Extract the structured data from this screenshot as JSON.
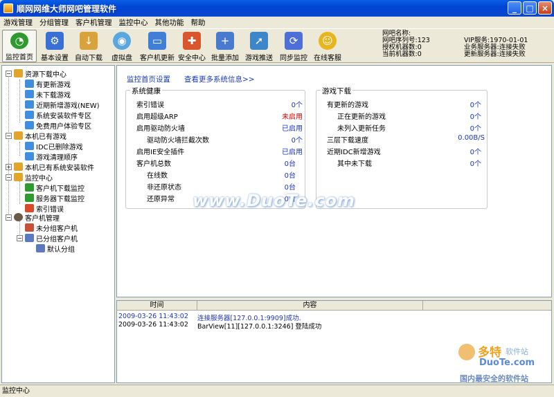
{
  "window": {
    "title": "顺网网维大师网吧管理软件",
    "minimize": "_",
    "maximize": "□",
    "close": "×"
  },
  "menu": [
    "游戏管理",
    "分组管理",
    "客户机管理",
    "监控中心",
    "其他功能",
    "帮助"
  ],
  "toolbar": {
    "buttons": [
      {
        "label": "监控首页",
        "icon": "pie-chart-icon",
        "color": "#2f9a2f"
      },
      {
        "label": "基本设置",
        "icon": "gear-icon",
        "color": "#3a6fd6"
      },
      {
        "label": "自动下载",
        "icon": "download-icon",
        "color": "#d9a23a"
      },
      {
        "label": "虚拟盘",
        "icon": "disk-icon",
        "color": "#5aa7e0"
      },
      {
        "label": "客户机更新",
        "icon": "monitor-icon",
        "color": "#3f7fd8"
      },
      {
        "label": "安全中心",
        "icon": "shield-icon",
        "color": "#d8552e"
      },
      {
        "label": "批量添加",
        "icon": "add-icon",
        "color": "#4a7ad0"
      },
      {
        "label": "游戏推送",
        "icon": "push-icon",
        "color": "#3c86c9"
      },
      {
        "label": "同步监控",
        "icon": "sync-icon",
        "color": "#4f6fd8"
      },
      {
        "label": "在线客服",
        "icon": "smiley-icon",
        "color": "#e9b51f"
      }
    ]
  },
  "netbar_info": {
    "name": "网吧名称:",
    "serial": "网吧序列号:123",
    "licensed": "授权机器数:0",
    "current": "当前机器数:0",
    "vip": "VIP服务:1970-01-01",
    "business": "业务服务器:连接失败",
    "update": "更新服务器:连接失败"
  },
  "tree": {
    "resources": "资源下载中心",
    "updated_games": "有更新游戏",
    "not_downloaded": "未下载游戏",
    "recent_new": "近期新增游戏(NEW)",
    "sys_software": "系统安装软件专区",
    "free_trial": "免费用户体验专区",
    "local_games": "本机已有游戏",
    "idc_deleted": "IDC已删除游戏",
    "cleanup_order": "游戏清理顺序",
    "local_software": "本机已有系统安装软件",
    "monitor_center": "监控中心",
    "client_dl_monitor": "客户机下载监控",
    "server_dl_monitor": "服务器下载监控",
    "index_error": "索引错误",
    "client_mgmt": "客户机管理",
    "ungrouped": "未分组客户机",
    "grouped": "已分组客户机",
    "default_group": "默认分组"
  },
  "main": {
    "settings_link": "监控首页设置",
    "more_link": "查看更多系统信息>>",
    "health": {
      "title": "系统健康",
      "rows": [
        {
          "label": "索引错误",
          "value": "0个"
        },
        {
          "label": "启用超级ARP",
          "value": "未启用"
        },
        {
          "label": "启用驱动防火墙",
          "value": "已启用"
        },
        {
          "label": "驱动防火墙拦截次数",
          "value": "0个"
        },
        {
          "label": "启用IE安全插件",
          "value": "已启用"
        },
        {
          "label": "客户机总数",
          "value": "0台"
        },
        {
          "label": "在线数",
          "value": "0台"
        },
        {
          "label": "非还原状态",
          "value": "0台"
        },
        {
          "label": "还原异常",
          "value": "0台"
        }
      ]
    },
    "downloads": {
      "title": "游戏下载",
      "rows": [
        {
          "label": "有更新的游戏",
          "value": "0个"
        },
        {
          "label": "正在更新的游戏",
          "value": "0个"
        },
        {
          "label": "未列入更新任务",
          "value": "0个"
        },
        {
          "label": "三层下载速度",
          "value": "0.00B/S"
        },
        {
          "label": "近期IDC新增游戏",
          "value": "0个"
        },
        {
          "label": "其中未下载",
          "value": "0个"
        }
      ]
    }
  },
  "log": {
    "col_time": "时间",
    "col_content": "内容",
    "rows": [
      {
        "time": "2009-03-26 11:43:02",
        "content": "连接服务器[127.0.0.1:9909]成功."
      },
      {
        "time": "2009-03-26 11:43:02",
        "content": "BarView[11][127.0.0.1:3246] 登陆成功"
      }
    ]
  },
  "status": "监控中心",
  "watermark": {
    "main": "www.DuoTe.com",
    "logo": "多特",
    "logo_sub": "软件站",
    "site": "DuoTe.com",
    "slogan": "国内最安全的软件站"
  },
  "colors": {
    "blue_value": "#1c35b8",
    "red_value": "#e00000",
    "link": "#1a3dbb"
  }
}
